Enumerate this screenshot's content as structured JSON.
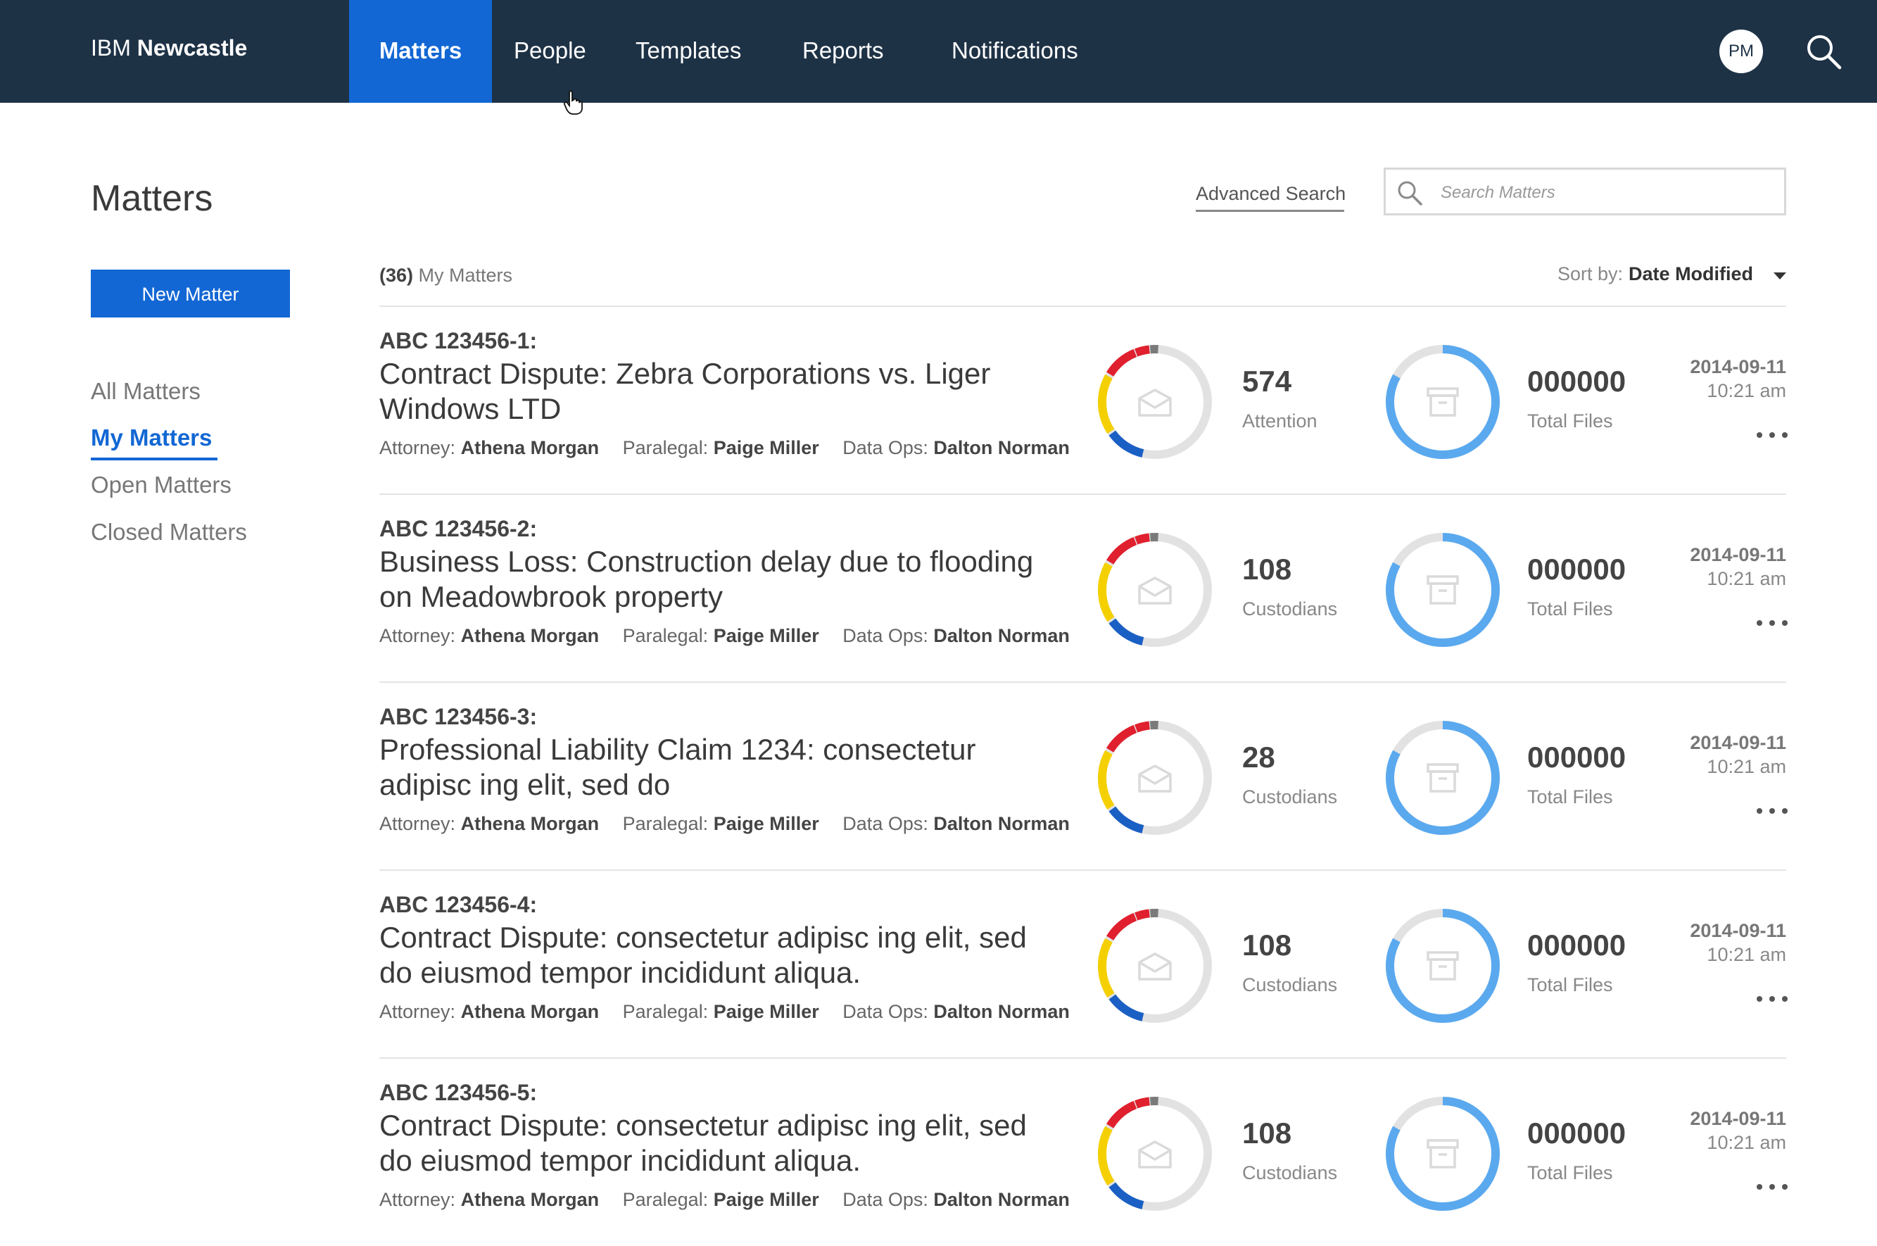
{
  "brand": {
    "prefix": "IBM",
    "name": "Newcastle"
  },
  "nav": {
    "items": [
      {
        "label": "Matters",
        "active": true
      },
      {
        "label": "People"
      },
      {
        "label": "Templates"
      },
      {
        "label": "Reports"
      },
      {
        "label": "Notifications"
      }
    ],
    "avatar_initials": "PM"
  },
  "page": {
    "title": "Matters",
    "new_matter_label": "New Matter",
    "advanced_search_label": "Advanced Search",
    "search_placeholder": "Search Matters"
  },
  "sidebar": {
    "items": [
      {
        "label": "All Matters"
      },
      {
        "label": "My Matters",
        "active": true
      },
      {
        "label": "Open Matters"
      },
      {
        "label": "Closed Matters"
      }
    ]
  },
  "list": {
    "count": "(36)",
    "label": "My Matters",
    "sort_label": "Sort by:",
    "sort_value": "Date Modified"
  },
  "labels": {
    "attorney": "Attorney:",
    "paralegal": "Paralegal:",
    "data_ops": "Data Ops:"
  },
  "colors": {
    "nav_bg": "#1e3246",
    "accent": "#1267d4",
    "ring_red": "#e0202e",
    "ring_yellow": "#f5d000",
    "ring_blue": "#1a5fc4",
    "ring_gray": "#7a7a7a",
    "ring_light": "#e2e2e2",
    "files_blue": "#5aa9ef"
  },
  "matters": [
    {
      "id": "ABC 123456-1:",
      "title": "Contract Dispute: Zebra Corporations vs. Liger Windows LTD",
      "attorney": "Athena Morgan",
      "paralegal": "Paige Miller",
      "data_ops": "Dalton Norman",
      "stat_value": "574",
      "stat_label": "Attention",
      "files_value": "000000",
      "files_label": "Total Files",
      "date": "2014-09-11",
      "time": "10:21 am"
    },
    {
      "id": "ABC 123456-2:",
      "title": "Business Loss: Construction delay due to flooding on Meadowbrook property",
      "attorney": "Athena Morgan",
      "paralegal": "Paige Miller",
      "data_ops": "Dalton Norman",
      "stat_value": "108",
      "stat_label": "Custodians",
      "files_value": "000000",
      "files_label": "Total Files",
      "date": "2014-09-11",
      "time": "10:21 am"
    },
    {
      "id": "ABC 123456-3:",
      "title": "Professional Liability Claim 1234: consectetur adipisc ing elit, sed do",
      "attorney": "Athena Morgan",
      "paralegal": "Paige Miller",
      "data_ops": "Dalton Norman",
      "stat_value": "28",
      "stat_label": "Custodians",
      "files_value": "000000",
      "files_label": "Total Files",
      "date": "2014-09-11",
      "time": "10:21 am"
    },
    {
      "id": "ABC 123456-4:",
      "title": "Contract Dispute: consectetur adipisc ing elit, sed do eiusmod tempor incididunt aliqua.",
      "attorney": "Athena Morgan",
      "paralegal": "Paige Miller",
      "data_ops": "Dalton Norman",
      "stat_value": "108",
      "stat_label": "Custodians",
      "files_value": "000000",
      "files_label": "Total Files",
      "date": "2014-09-11",
      "time": "10:21 am"
    },
    {
      "id": "ABC 123456-5:",
      "title": "Contract Dispute: consectetur adipisc ing elit, sed do eiusmod tempor incididunt aliqua.",
      "attorney": "Athena Morgan",
      "paralegal": "Paige Miller",
      "data_ops": "Dalton Norman",
      "stat_value": "108",
      "stat_label": "Custodians",
      "files_value": "000000",
      "files_label": "Total Files",
      "date": "2014-09-11",
      "time": "10:21 am"
    }
  ]
}
